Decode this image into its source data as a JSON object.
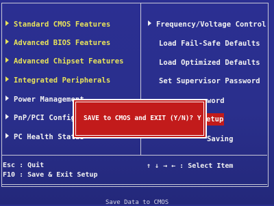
{
  "left_menu": [
    {
      "label": "Standard CMOS Features"
    },
    {
      "label": "Advanced BIOS Features"
    },
    {
      "label": "Advanced Chipset Features"
    },
    {
      "label": "Integrated Peripherals"
    },
    {
      "label": "Power Management"
    },
    {
      "label": "PnP/PCI Configura"
    },
    {
      "label": "PC Health Status"
    }
  ],
  "right_menu": [
    {
      "label": "Frequency/Voltage Control"
    },
    {
      "label": "Load Fail-Safe Defaults"
    },
    {
      "label": "Load Optimized Defaults"
    },
    {
      "label": "Set Supervisor Password"
    },
    {
      "label": "word"
    },
    {
      "label": "etup"
    },
    {
      "label": "Saving"
    }
  ],
  "dialog": {
    "prompt": "SAVE to CMOS and EXIT (Y/N)? Y"
  },
  "help": {
    "esc": "Esc : Quit",
    "f10": "F10 : Save & Exit Setup",
    "nav": "↑ ↓ → ←  : Select Item"
  },
  "status_bar": {
    "text": "Save Data to CMOS"
  },
  "colors": {
    "background": "#2a2f8e",
    "menu_text": "#e8e35a",
    "dialog_bg": "#c21b1b",
    "border": "#c9c9d8"
  }
}
